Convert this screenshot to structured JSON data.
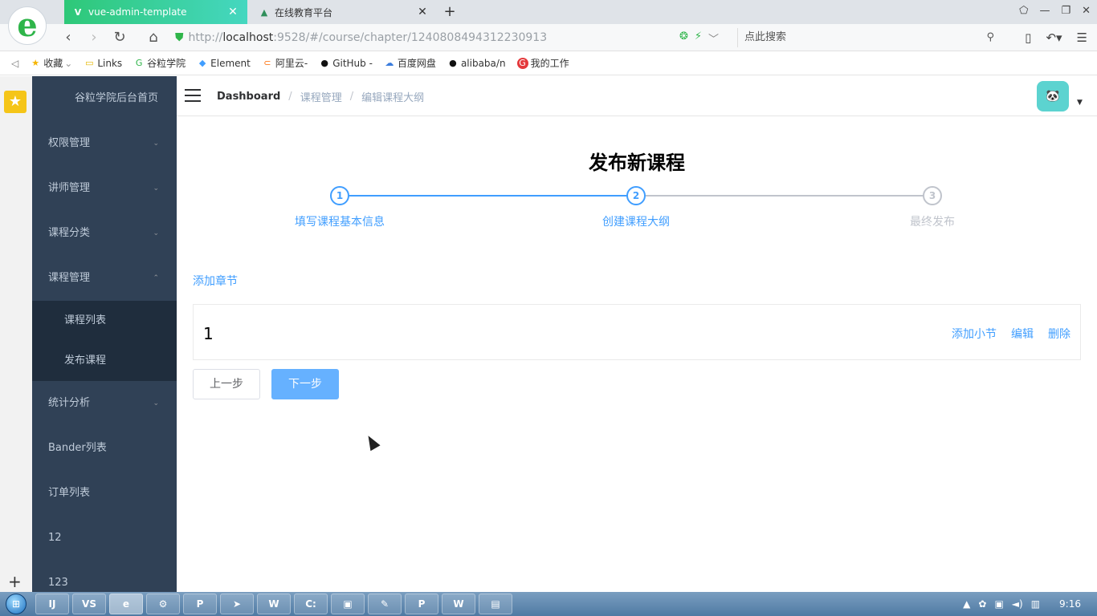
{
  "browser": {
    "tabs": [
      {
        "title": "vue-admin-template",
        "favicon": "V"
      },
      {
        "title": "在线教育平台",
        "favicon": "▲"
      }
    ],
    "url_prefix": "http://",
    "url_host": "localhost",
    "url_rest": ":9528/#/course/chapter/1240808494312230913",
    "search_placeholder": "点此搜索",
    "bookmarks": [
      {
        "label": "收藏",
        "icon": "★"
      },
      {
        "label": "Links",
        "icon": "▭"
      },
      {
        "label": "谷粒学院",
        "icon": "G"
      },
      {
        "label": "Element",
        "icon": "◆"
      },
      {
        "label": "阿里云-",
        "icon": "⊂"
      },
      {
        "label": "GitHub -",
        "icon": "●"
      },
      {
        "label": "百度网盘",
        "icon": "☁"
      },
      {
        "label": "alibaba/n",
        "icon": "●"
      },
      {
        "label": "我的工作",
        "icon": "G"
      }
    ]
  },
  "sidebar": {
    "title": "谷粒学院后台首页",
    "items": [
      {
        "label": "权限管理",
        "arrow": "⌄"
      },
      {
        "label": "讲师管理",
        "arrow": "⌄"
      },
      {
        "label": "课程分类",
        "arrow": "⌄"
      },
      {
        "label": "课程管理",
        "arrow": "⌃"
      }
    ],
    "sub_items": [
      {
        "label": "课程列表"
      },
      {
        "label": "发布课程"
      }
    ],
    "items_after": [
      {
        "label": "统计分析",
        "arrow": "⌄"
      },
      {
        "label": "Bander列表"
      },
      {
        "label": "订单列表"
      },
      {
        "label": "12"
      },
      {
        "label": "123"
      }
    ]
  },
  "navbar": {
    "breadcrumb": [
      "Dashboard",
      "课程管理",
      "编辑课程大纲"
    ],
    "separator": "/"
  },
  "main": {
    "heading": "发布新课程",
    "steps": [
      {
        "number": "1",
        "label": "填写课程基本信息",
        "status": "done"
      },
      {
        "number": "2",
        "label": "创建课程大纲",
        "status": "current"
      },
      {
        "number": "3",
        "label": "最终发布",
        "status": "todo"
      }
    ],
    "add_chapter_label": "添加章节",
    "chapters": [
      {
        "title": "1",
        "actions": [
          "添加小节",
          "编辑",
          "删除"
        ]
      }
    ],
    "prev_button": "上一步",
    "next_button": "下一步"
  },
  "taskbar": {
    "apps": [
      "IJ",
      "VS",
      "e",
      "⚙",
      "P",
      "➤",
      "W",
      "C:",
      "▣",
      "✎",
      "P",
      "W",
      "▤"
    ],
    "clock": "9:16"
  },
  "colors": {
    "primary": "#409eff",
    "sidebar_bg": "#304156",
    "sidebar_sub_bg": "#1f2d3d",
    "next_button_bg": "#66b1ff"
  }
}
